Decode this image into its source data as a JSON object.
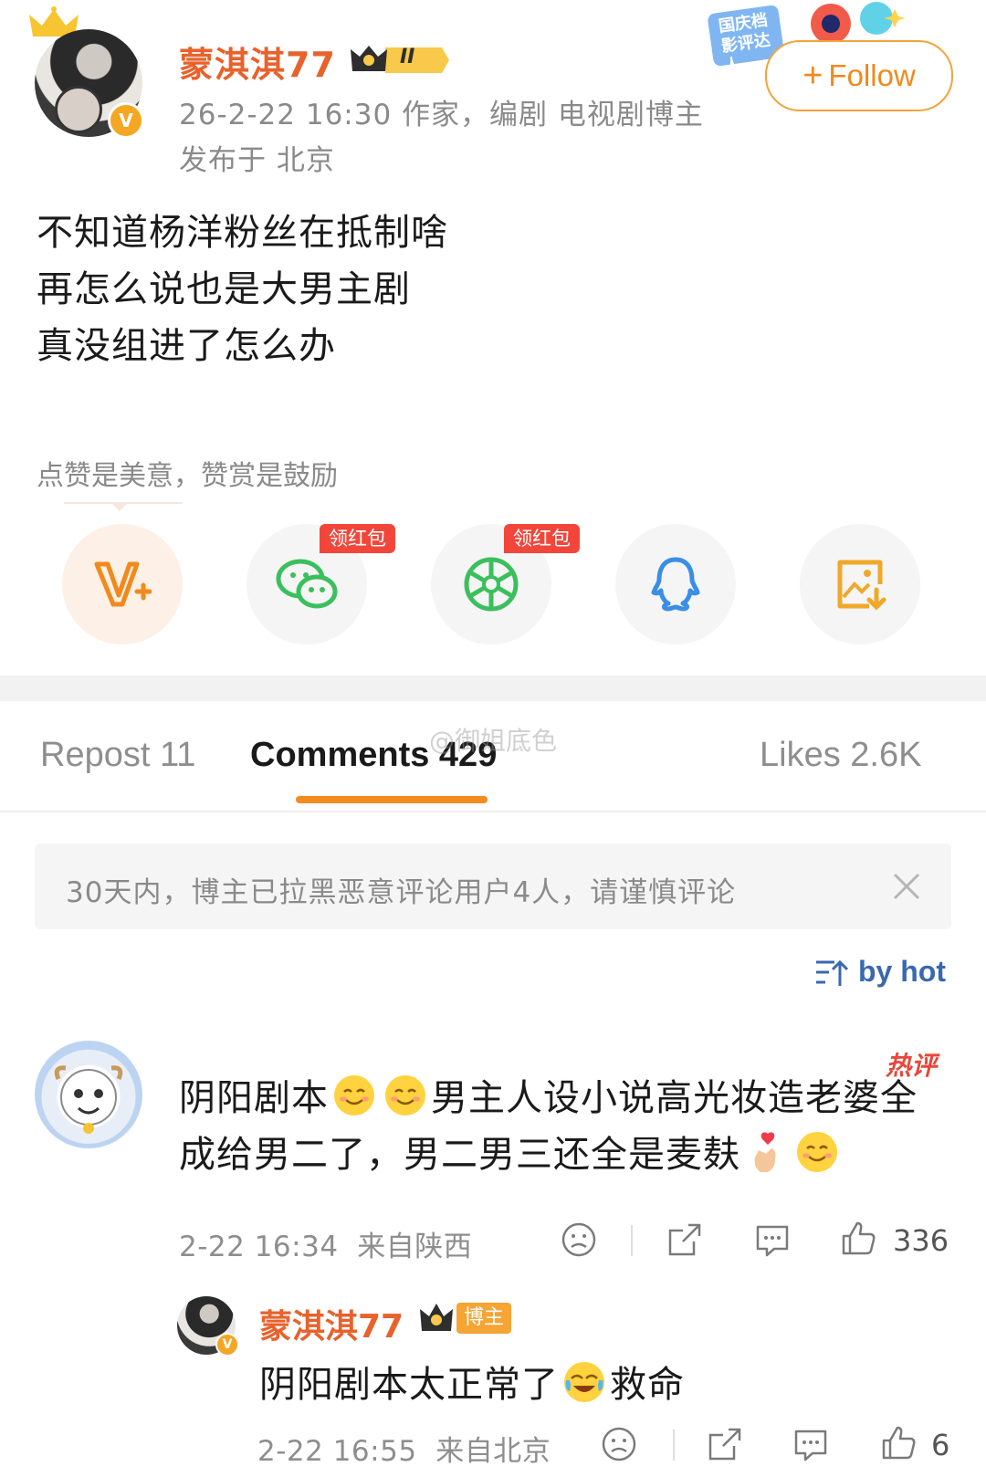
{
  "post": {
    "author": {
      "name": "蒙淇淇77",
      "level_badge": "II",
      "verified_badge": "V"
    },
    "meta_line1": "26-2-22 16:30  作家，编剧 电视剧博主",
    "meta_line2": "发布于 北京",
    "promo_badge": "国庆档影评达人",
    "follow_label": "Follow",
    "body_lines": [
      "不知道杨洋粉丝在抵制啥",
      "再怎么说也是大男主剧",
      "真没组进了怎么办"
    ],
    "reward_hint": "点赞是美意，赞赏是鼓励"
  },
  "share": {
    "red_packet_label": "领红包",
    "items": [
      {
        "icon": "reward-v-icon",
        "color": "#f08a1c"
      },
      {
        "icon": "wechat-icon",
        "color": "#3bbf5e",
        "tag": true
      },
      {
        "icon": "moments-icon",
        "color": "#3bbf5e",
        "tag": true
      },
      {
        "icon": "qq-icon",
        "color": "#3a8ee6"
      },
      {
        "icon": "save-image-icon",
        "color": "#f0a82a"
      }
    ]
  },
  "tabs": [
    {
      "label": "Repost 11",
      "active": false
    },
    {
      "label": "Comments 429",
      "active": true
    },
    {
      "label": "Likes 2.6K",
      "active": false
    }
  ],
  "watermark": "@御姐底色",
  "notice": {
    "text": "30天内，博主已拉黑恶意评论用户4人，请谨慎评论"
  },
  "sort_label": "by hot",
  "comment": {
    "hot_tag": "热评",
    "text_part1": "阴阳剧本",
    "text_part2": "男主人设小说高光妆造老婆全",
    "text_part3": "成给男二了，男二男三还全是麦麸",
    "time": "2-22 16:34",
    "location": "来自陕西",
    "likes": "336"
  },
  "reply": {
    "author": "蒙淇淇77",
    "blogger_tag": "博主",
    "text_part1": "阴阳剧本太正常了",
    "text_part2": "救命",
    "time": "2-22 16:55",
    "location": "来自北京",
    "likes": "6"
  },
  "colors": {
    "accent_orange": "#f08a1c",
    "username_orange": "#e8622c",
    "red_tag": "#f2463b",
    "link_blue": "#3a68b0"
  }
}
